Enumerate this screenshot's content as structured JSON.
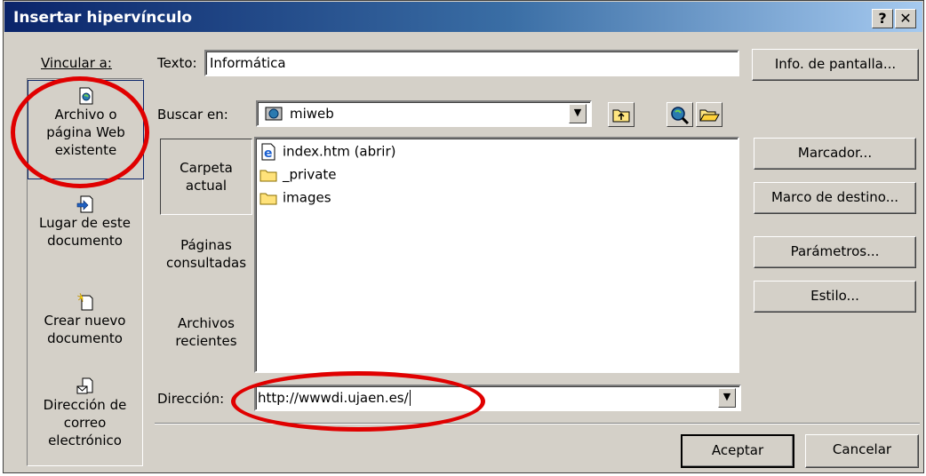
{
  "window": {
    "title": "Insertar hipervínculo",
    "help_label": "?",
    "close_label": "✕"
  },
  "left": {
    "heading": "Vincular a:",
    "items": [
      {
        "line1": "Archivo o",
        "line2": "página Web",
        "line3": "existente",
        "icon": "file-web-icon",
        "selected": true
      },
      {
        "line1": "Lugar de este",
        "line2": "documento",
        "icon": "document-place-icon"
      },
      {
        "line1": "Crear nuevo",
        "line2": "documento",
        "icon": "new-document-icon"
      },
      {
        "line1": "Dirección de",
        "line2": "correo",
        "line3": "electrónico",
        "icon": "email-icon"
      }
    ]
  },
  "texto": {
    "label": "Texto:",
    "value": "Informática"
  },
  "screentip_button": "Info. de pantalla...",
  "buscar": {
    "label": "Buscar en:",
    "value": "miweb"
  },
  "side_tabs": [
    {
      "line1": "Carpeta",
      "line2": "actual"
    },
    {
      "line1": "Páginas",
      "line2": "consultadas"
    },
    {
      "line1": "Archivos",
      "line2": "recientes"
    }
  ],
  "files": [
    {
      "name": "index.htm (abrir)",
      "icon": "ie-document-icon"
    },
    {
      "name": "_private",
      "icon": "folder-icon"
    },
    {
      "name": "images",
      "icon": "folder-icon"
    }
  ],
  "right_buttons": {
    "marcador": "Marcador...",
    "marco": "Marco de destino...",
    "parametros": "Parámetros...",
    "estilo": "Estilo..."
  },
  "direccion": {
    "label": "Dirección:",
    "value": "http://wwwdi.ujaen.es/"
  },
  "footer": {
    "ok": "Aceptar",
    "cancel": "Cancelar"
  },
  "colors": {
    "face": "#d4d0c8",
    "title_start": "#0a246a",
    "highlight_circle": "#e00000"
  }
}
